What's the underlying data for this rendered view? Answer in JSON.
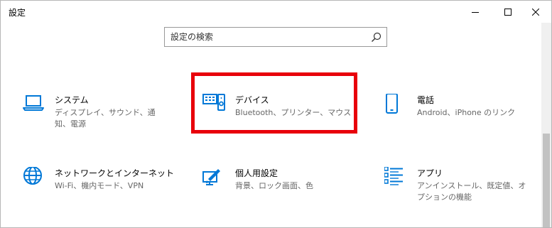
{
  "window": {
    "title": "設定"
  },
  "search": {
    "placeholder": "設定の検索",
    "value": ""
  },
  "accent_color": "#0078d7",
  "highlight_color": "#e8000b",
  "categories": [
    {
      "name": "システム",
      "description": "ディスプレイ、サウンド、通知、電源",
      "icon": "laptop-icon"
    },
    {
      "name": "デバイス",
      "description": "Bluetooth、プリンター、マウス",
      "icon": "keyboard-speaker-icon"
    },
    {
      "name": "電話",
      "description": "Android、iPhone のリンク",
      "icon": "phone-icon"
    },
    {
      "name": "ネットワークとインターネット",
      "description": "Wi-Fi、機内モード、VPN",
      "icon": "globe-icon"
    },
    {
      "name": "個人用設定",
      "description": "背景、ロック画面、色",
      "icon": "paintbrush-icon"
    },
    {
      "name": "アプリ",
      "description": "アンインストール、既定値、オプションの機能",
      "icon": "app-list-icon"
    }
  ]
}
